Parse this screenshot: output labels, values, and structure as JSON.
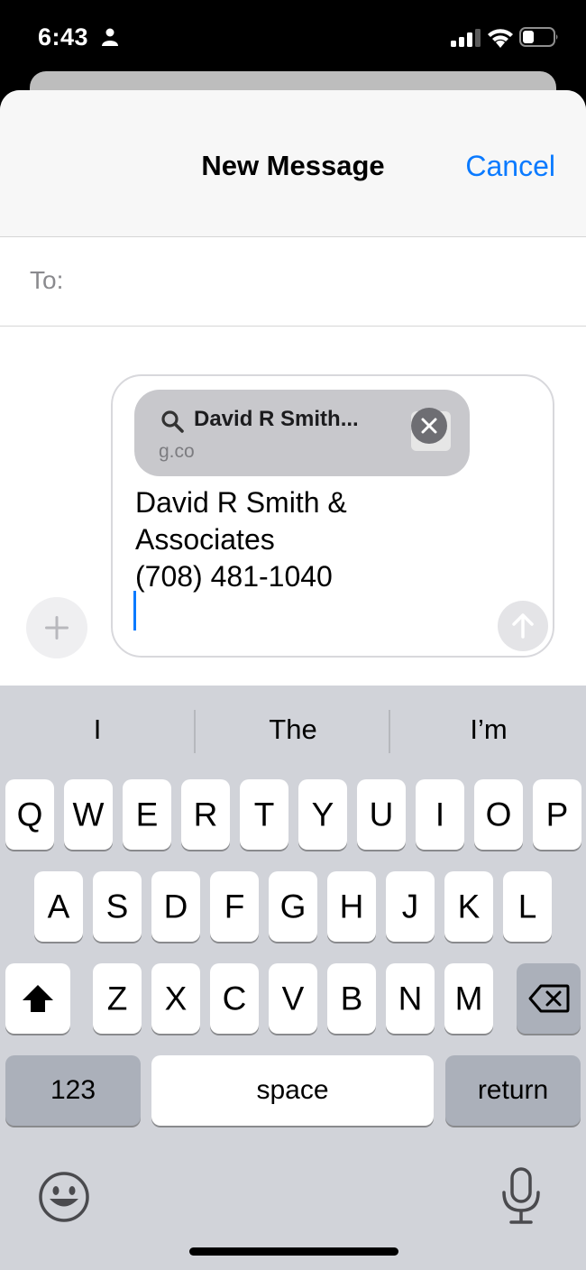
{
  "status_bar": {
    "time": "6:43"
  },
  "header": {
    "title": "New Message",
    "cancel_label": "Cancel"
  },
  "recipient": {
    "to_label": "To:"
  },
  "compose": {
    "link_preview": {
      "title": "David R Smith...",
      "domain": "g.co"
    },
    "message_text": "David R Smith &\nAssociates\n(708) 481-1040"
  },
  "keyboard": {
    "predictions": [
      "I",
      "The",
      "I’m"
    ],
    "row1": [
      "Q",
      "W",
      "E",
      "R",
      "T",
      "Y",
      "U",
      "I",
      "O",
      "P"
    ],
    "row2": [
      "A",
      "S",
      "D",
      "F",
      "G",
      "H",
      "J",
      "K",
      "L"
    ],
    "row3": [
      "Z",
      "X",
      "C",
      "V",
      "B",
      "N",
      "M"
    ],
    "numbers_label": "123",
    "space_label": "space",
    "return_label": "return"
  },
  "colors": {
    "accent": "#0a7aff",
    "keyboard_bg": "#d1d3d9",
    "dark_key": "#abb0ba"
  }
}
